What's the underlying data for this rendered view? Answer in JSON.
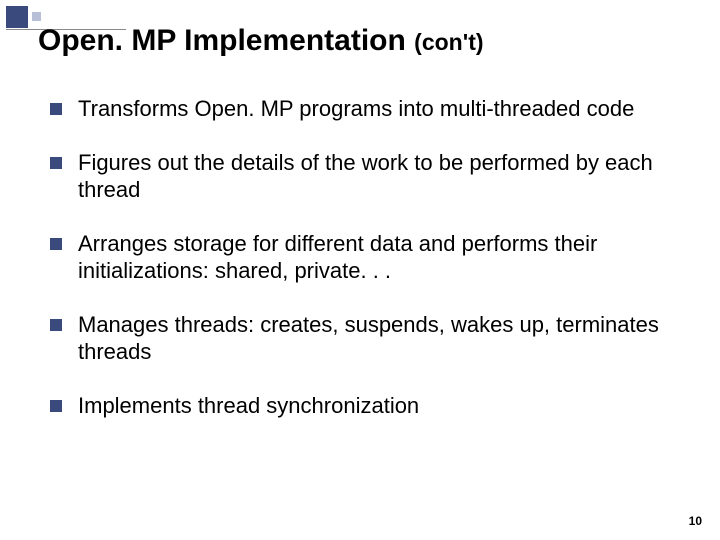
{
  "title": {
    "main": "Open. MP Implementation ",
    "sub": "(con't)"
  },
  "bullets": [
    "Transforms Open. MP programs into multi-threaded code",
    "Figures out the details of the work to be performed by each thread",
    "Arranges storage for different data and performs their initializations: shared, private. . .",
    "Manages threads: creates, suspends, wakes up, terminates threads",
    "Implements thread synchronization"
  ],
  "page_number": "10"
}
